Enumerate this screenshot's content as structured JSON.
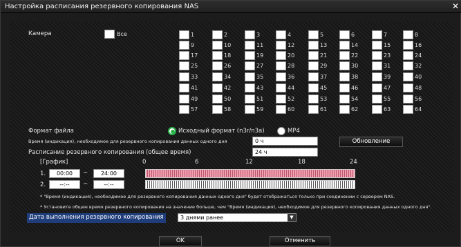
{
  "window": {
    "title": "Настройка расписания резервного копирования NAS"
  },
  "camera": {
    "label": "Камера",
    "all_label": "Все",
    "numbers": [
      "1",
      "2",
      "3",
      "4",
      "5",
      "6",
      "7",
      "8",
      "9",
      "10",
      "11",
      "12",
      "13",
      "14",
      "15",
      "16",
      "17",
      "18",
      "19",
      "20",
      "21",
      "22",
      "23",
      "24",
      "25",
      "26",
      "27",
      "28",
      "29",
      "30",
      "31",
      "32",
      "33",
      "34",
      "35",
      "36",
      "37",
      "38",
      "39",
      "40",
      "41",
      "42",
      "43",
      "44",
      "45",
      "46",
      "47",
      "48",
      "49",
      "50",
      "51",
      "52",
      "53",
      "54",
      "55",
      "56",
      "57",
      "58",
      "59",
      "60",
      "61",
      "62",
      "63",
      "64"
    ]
  },
  "format": {
    "label": "Формат файла",
    "option1": "Исходный формат (n3r/n3a)",
    "option2": "MP4",
    "selected": "option1"
  },
  "time_display": {
    "label": "Время (индикация), необходимое для резервного копирования данных одного дня",
    "value": "0 ч"
  },
  "refresh_button": "Обновление",
  "schedule_total": {
    "label": "Расписание резервного копирования (общее время)",
    "value": "24 ч"
  },
  "graph": {
    "label": "[График]",
    "ticks": [
      "0",
      "6",
      "12",
      "18",
      "24"
    ],
    "rows": [
      {
        "num": "1.",
        "start": "00:00",
        "end": "24:00"
      },
      {
        "num": "2.",
        "start": "--:--",
        "end": "--:--"
      }
    ],
    "tilde": "~"
  },
  "notes": [
    "* \"Время (индикация), необходимое для резервного копирования данных одного дня\" будет отображаться только при соединении с сервером NAS.",
    "* Установите общее время резервного копирования на значение больше, чем \"Время (индикация), необходимое для резервного копирования данных одного дня\"."
  ],
  "date": {
    "label": "Дата выполнения резервного копирования",
    "value": "3 днями ранее"
  },
  "buttons": {
    "ok": "OK",
    "cancel": "Отменить"
  },
  "colors": {
    "accent_green": "#2bb04a",
    "date_label_bg": "#1e3d7a",
    "bar1": "#f1a0b0"
  }
}
